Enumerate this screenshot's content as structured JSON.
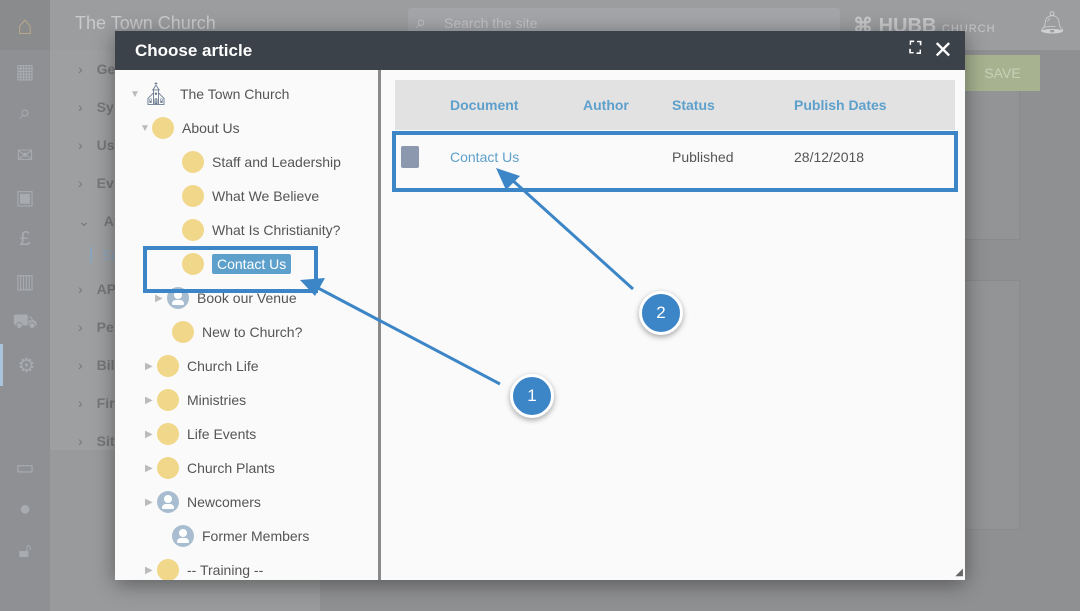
{
  "app": {
    "title": "The Town Church",
    "search_placeholder": "Search the site",
    "brand": "HUBB",
    "brand_sub": "CHURCH",
    "save_label": "SAVE"
  },
  "bg_menu": [
    "Ge",
    "Sy",
    "Us",
    "Ev",
    "Ap",
    "Se",
    "AP",
    "Pe",
    "Bil",
    "Fir",
    "Sit"
  ],
  "modal": {
    "title": "Choose article",
    "tree": [
      {
        "label": "The Town Church",
        "icon": "church-icon"
      },
      {
        "label": "About Us",
        "icon": "folder"
      },
      {
        "label": "Staff and Leadership",
        "icon": "folder"
      },
      {
        "label": "What We Believe",
        "icon": "folder"
      },
      {
        "label": "What Is Christianity?",
        "icon": "folder"
      },
      {
        "label": "Contact Us",
        "icon": "folder",
        "selected": true
      },
      {
        "label": "Book our Venue",
        "icon": "user"
      },
      {
        "label": "New to Church?",
        "icon": "folder"
      },
      {
        "label": "Church Life",
        "icon": "folder"
      },
      {
        "label": "Ministries",
        "icon": "folder"
      },
      {
        "label": "Life Events",
        "icon": "folder"
      },
      {
        "label": "Church Plants",
        "icon": "folder"
      },
      {
        "label": "Newcomers",
        "icon": "user"
      },
      {
        "label": "Former Members",
        "icon": "user"
      },
      {
        "label": "-- Training --",
        "icon": "folder"
      }
    ],
    "table": {
      "columns": [
        "Document",
        "Author",
        "Status",
        "Publish Dates"
      ],
      "rows": [
        {
          "document": "Contact Us",
          "author": "",
          "status": "Published",
          "publish_date": "28/12/2018"
        }
      ]
    }
  },
  "annotations": [
    {
      "label": "1"
    },
    {
      "label": "2"
    }
  ],
  "colors": {
    "accent": "#5ea0cc",
    "annotation": "#3c85c6",
    "modal_header": "#3b4249",
    "folder": "#f1d78a"
  }
}
